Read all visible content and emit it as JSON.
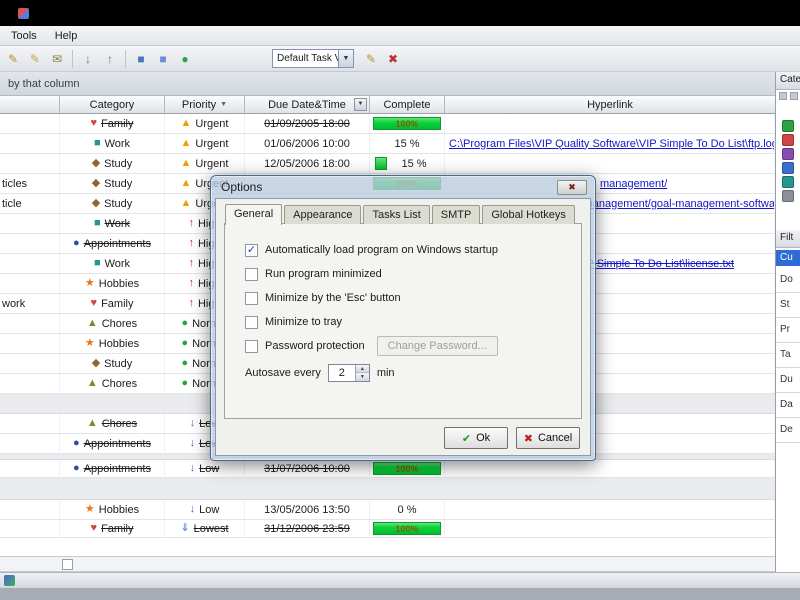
{
  "menubar": {
    "items": [
      "Tools",
      "Help"
    ]
  },
  "toolbar": {
    "combo_value": "Default Task V",
    "icons": [
      {
        "name": "new-task-icon",
        "glyph": "✎",
        "color": "#b8912a"
      },
      {
        "name": "edit-task-icon",
        "glyph": "✎",
        "color": "#c9a23a"
      },
      {
        "name": "mail-icon",
        "glyph": "✉",
        "color": "#8a7a40"
      },
      {
        "name": "move-down-icon",
        "glyph": "↓",
        "color": "#667788"
      },
      {
        "name": "move-up-icon",
        "glyph": "↑",
        "color": "#667788"
      },
      {
        "name": "panel-view-icon",
        "glyph": "■",
        "color": "#4878c0"
      },
      {
        "name": "grid-view-icon",
        "glyph": "■",
        "color": "#6890d0"
      },
      {
        "name": "refresh-icon",
        "glyph": "●",
        "color": "#2aa343"
      }
    ],
    "after_icons": [
      {
        "name": "edit-filter-icon",
        "glyph": "✎",
        "color": "#b8912a"
      },
      {
        "name": "delete-filter-icon",
        "glyph": "✖",
        "color": "#c03030"
      }
    ]
  },
  "group_bar": {
    "text": "by that column"
  },
  "table": {
    "headers": {
      "category": "Category",
      "priority": "Priority",
      "due": "Due Date&Time",
      "complete": "Complete",
      "hyperlink": "Hyperlink"
    },
    "category_icons": {
      "Family": {
        "glyph": "♥",
        "color": "#d04545"
      },
      "Work": {
        "glyph": "■",
        "color": "#27968f"
      },
      "Study": {
        "glyph": "◆",
        "color": "#8a6a2a"
      },
      "Appointments": {
        "glyph": "●",
        "color": "#3a4a9a"
      },
      "Hobbies": {
        "glyph": "★",
        "color": "#e07820"
      },
      "Chores": {
        "glyph": "▲",
        "color": "#7a8a2e"
      }
    },
    "priority_icons": {
      "Urgent": {
        "glyph": "▲",
        "color": "#f59a00"
      },
      "High": {
        "glyph": "↑",
        "color": "#d03020"
      },
      "Normal": {
        "glyph": "●",
        "color": "#2aa343"
      },
      "Low": {
        "glyph": "↓",
        "color": "#3a6fd0"
      },
      "Lowest": {
        "glyph": "⇓",
        "color": "#3a6fd0"
      }
    },
    "rows": [
      {
        "category": "Family",
        "category_done": true,
        "priority": "Urgent",
        "due": "01/09/2005 18:00",
        "due_done": true,
        "complete": {
          "type": "bar",
          "text": "100%"
        }
      },
      {
        "category": "Work",
        "priority": "Urgent",
        "due": "01/06/2006 10:00",
        "complete": {
          "type": "text",
          "text": "15 %"
        },
        "link": {
          "text": "C:\\Program Files\\VIP Quality Software\\VIP Simple To Do List\\ftp.log"
        }
      },
      {
        "category": "Study",
        "priority": "Urgent",
        "due": "12/05/2006 18:00",
        "complete": {
          "type": "bartext",
          "text": "15 %"
        }
      },
      {
        "name": "ticles",
        "category": "Study",
        "priority": "Urgent",
        "complete": {
          "type": "bar",
          "text": "100%"
        },
        "link": {
          "text": "management/",
          "offset": 155
        }
      },
      {
        "name": "ticle",
        "category": "Study",
        "priority": "Urgent",
        "link": {
          "text": "s/management/goal-management-software",
          "offset": 130
        }
      },
      {
        "category": "Work",
        "category_done": true,
        "priority": "High"
      },
      {
        "category": "Appointments",
        "category_done": true,
        "priority": "High"
      },
      {
        "category": "Work",
        "priority": "High",
        "link": {
          "text": "t\\VIP Simple To Do List\\license.txt",
          "offset": 125,
          "done": true
        }
      },
      {
        "category": "Hobbies",
        "priority": "High"
      },
      {
        "name": "work",
        "category": "Family",
        "priority": "High"
      },
      {
        "category": "Chores",
        "priority": "Normal"
      },
      {
        "category": "Hobbies",
        "priority": "Normal"
      },
      {
        "category": "Study",
        "priority": "Normal"
      },
      {
        "category": "Chores",
        "priority": "Normal"
      },
      {
        "type": "spacer",
        "h": 20
      },
      {
        "category": "Chores",
        "category_done": true,
        "priority": "Low",
        "priority_done": true
      },
      {
        "category": "Appointments",
        "category_done": true,
        "priority": "Low",
        "priority_done": true
      },
      {
        "type": "spacer",
        "h": 6
      },
      {
        "category": "Appointments",
        "category_done": true,
        "priority": "Low",
        "priority_done": true,
        "due": "31/07/2006 10:00",
        "due_done": true,
        "complete": {
          "type": "bar",
          "text": "100%"
        },
        "h": 18
      },
      {
        "type": "spacer",
        "h": 22
      },
      {
        "category": "Hobbies",
        "priority": "Low",
        "due": "13/05/2006 13:50",
        "complete": {
          "type": "text",
          "text": "0 %"
        }
      },
      {
        "category": "Family",
        "category_done": true,
        "priority": "Lowest",
        "priority_done": true,
        "due": "31/12/2006 23:59",
        "due_done": true,
        "complete": {
          "type": "bar",
          "text": "100%"
        },
        "h": 18
      }
    ]
  },
  "sidebar": {
    "categories_title": "Cate",
    "category_colors": [
      "#2aa343",
      "#d04545",
      "#8a4ab0",
      "#3a6fd0",
      "#27968f",
      "#8a8f98"
    ],
    "filter_title": "Filt",
    "selected_item": "Cu",
    "items": [
      "Do",
      "St",
      "Pr",
      "Ta",
      "Du",
      "Da",
      "De"
    ]
  },
  "dialog": {
    "title": "Options",
    "close_glyph": "✖",
    "tabs": [
      "General",
      "Appearance",
      "Tasks List",
      "SMTP",
      "Global Hotkeys"
    ],
    "checkboxes": [
      {
        "label": "Automatically load program on Windows startup",
        "checked": true
      },
      {
        "label": "Run program minimized",
        "checked": false
      },
      {
        "label": "Minimize by the 'Esc' button",
        "checked": false
      },
      {
        "label": "Minimize to tray",
        "checked": false
      },
      {
        "label": "Password protection",
        "checked": false,
        "button": "Change Password..."
      }
    ],
    "autosave_label": "Autosave every",
    "autosave_value": "2",
    "autosave_unit": "min",
    "ok_label": "Ok",
    "cancel_label": "Cancel"
  }
}
